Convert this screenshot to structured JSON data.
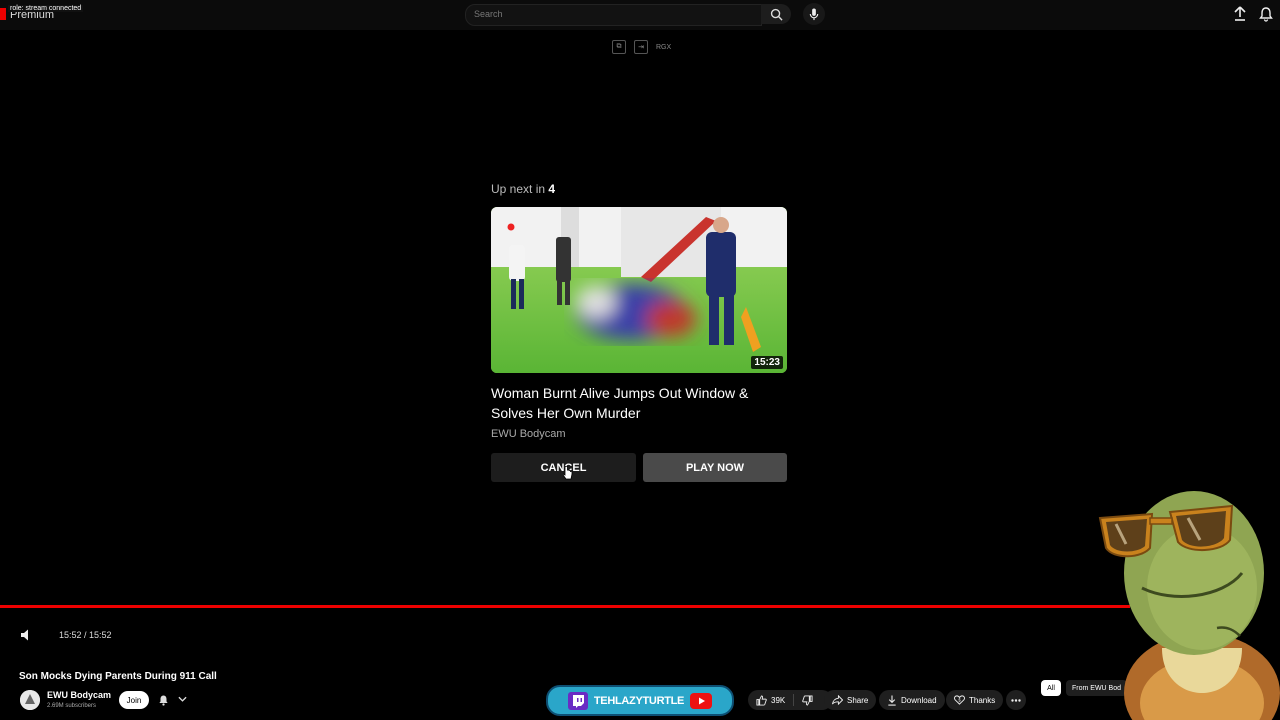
{
  "header": {
    "logo_text": "Premium",
    "overlay_text": "role: stream connected",
    "search_placeholder": "Search"
  },
  "toolbar": {
    "mini_label": "RGX"
  },
  "up_next": {
    "prefix": "Up next in",
    "countdown": "4",
    "duration": "15:23",
    "title": "Woman Burnt Alive Jumps Out Window & Solves Her Own Murder",
    "channel": "EWU Bodycam",
    "cancel_label": "CANCEL",
    "play_label": "PLAY NOW"
  },
  "player": {
    "time": "15:52 / 15:52",
    "progress": 1.0,
    "progress_color": "#ee0000"
  },
  "video": {
    "title": "Son Mocks Dying Parents During 911 Call",
    "channel": "EWU Bodycam",
    "subscribers": "2.69M subscribers",
    "join_label": "Join",
    "likes": "39K",
    "share_label": "Share",
    "download_label": "Download",
    "thanks_label": "Thanks"
  },
  "banner": {
    "text": "TEHLAZYTURTLE"
  },
  "chips": {
    "all": "All",
    "from_channel": "From EWU Bod"
  }
}
